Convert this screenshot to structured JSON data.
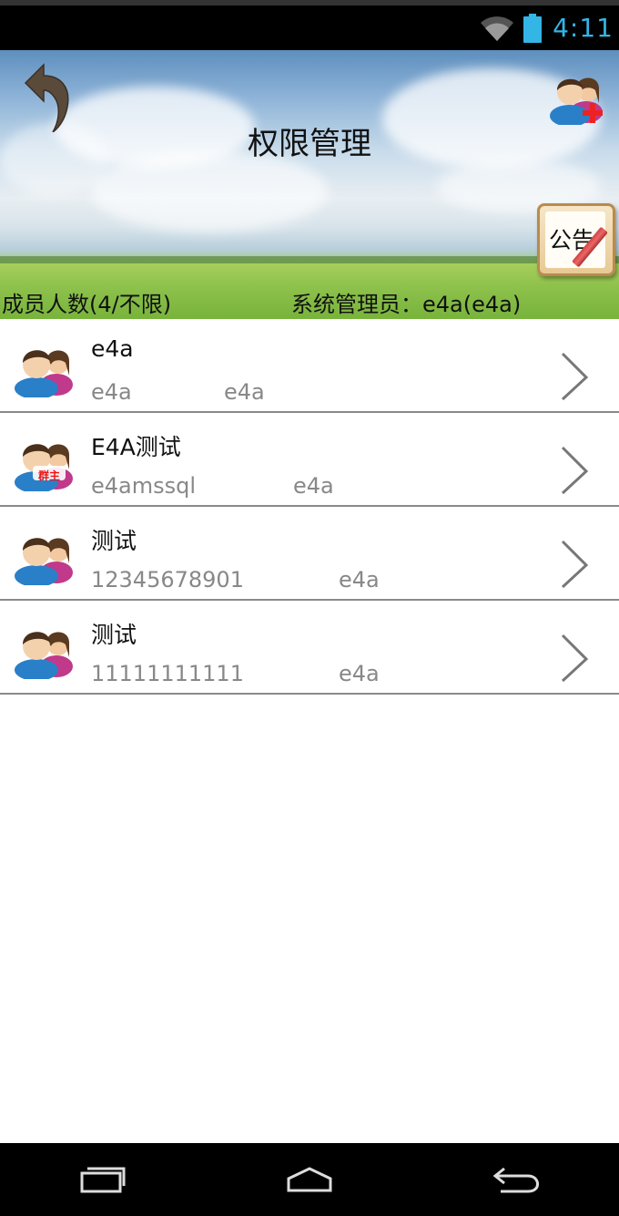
{
  "status_bar": {
    "time": "4:11",
    "accent_color": "#33b5e5",
    "icons": [
      "wifi-icon",
      "battery-icon"
    ]
  },
  "header": {
    "title": "权限管理",
    "back_icon": "back-arrow-icon",
    "add_member_icon": "add-user-icon",
    "notice_label": "公告"
  },
  "info": {
    "members": "成员人数(4/不限)",
    "admin": "系统管理员：e4a(e4a)"
  },
  "list": {
    "items": [
      {
        "name": "e4a",
        "account": "e4a",
        "owner": "e4a",
        "badge": ""
      },
      {
        "name": "E4A测试",
        "account": "e4amssql",
        "owner": "e4a",
        "badge": "群主"
      },
      {
        "name": "测试",
        "account": "12345678901",
        "owner": "e4a",
        "badge": ""
      },
      {
        "name": "测试",
        "account": "11111111111",
        "owner": "e4a",
        "badge": ""
      }
    ]
  },
  "nav_bar": {
    "icons": [
      "recent-apps-icon",
      "home-icon",
      "back-icon"
    ]
  }
}
